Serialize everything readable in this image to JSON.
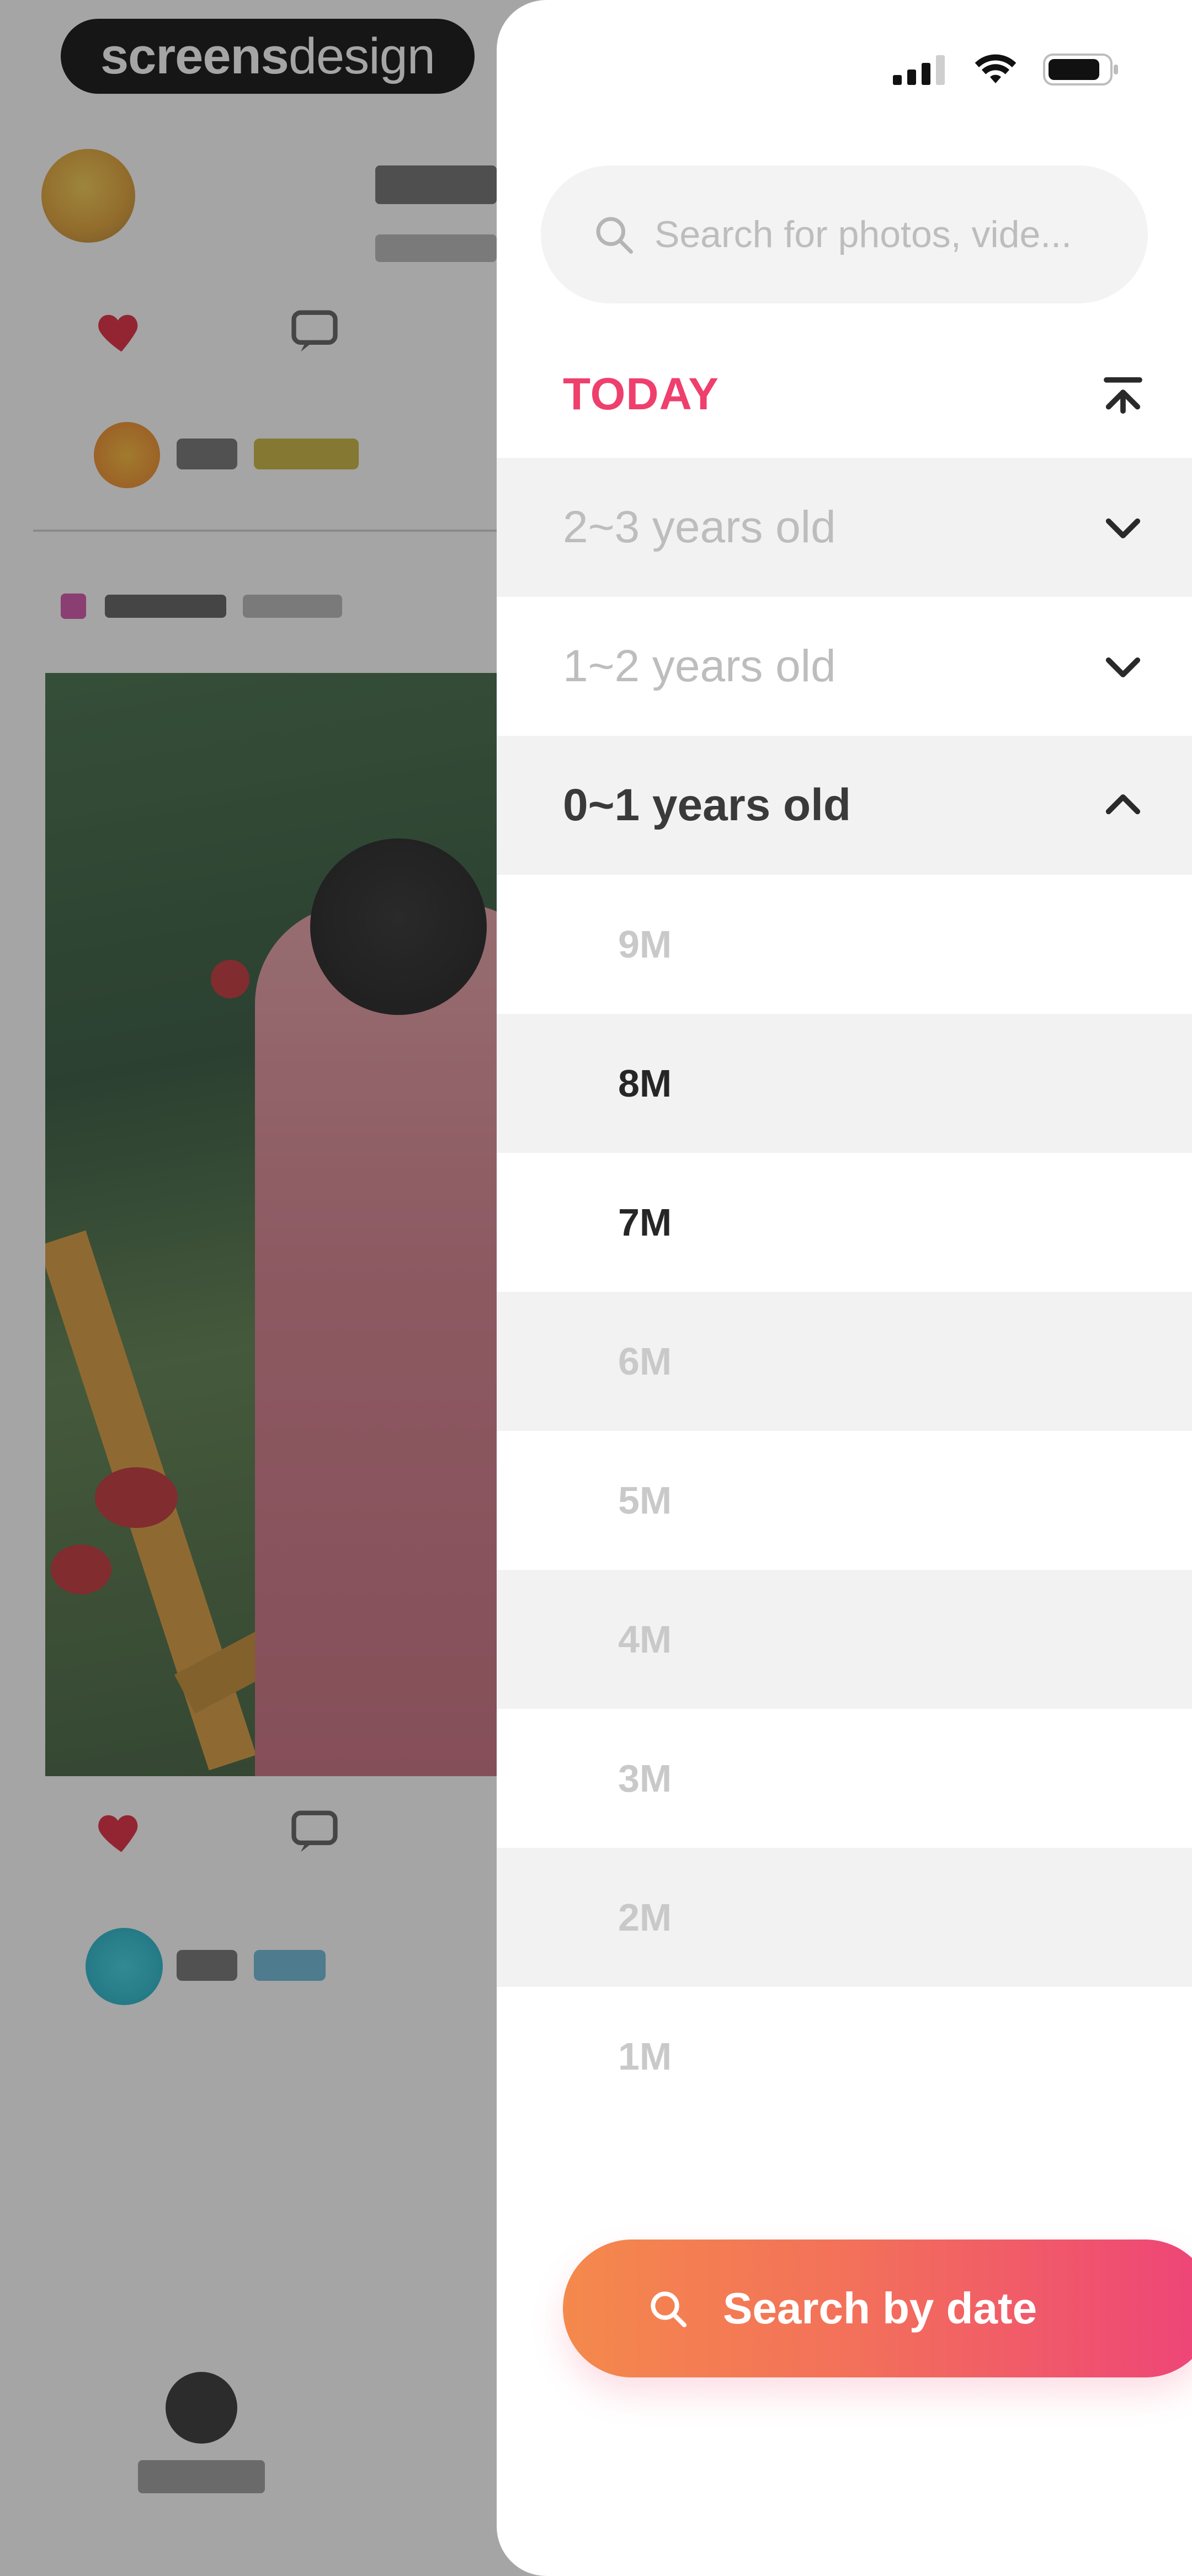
{
  "brand": {
    "bold": "screens",
    "light": "design"
  },
  "search": {
    "placeholder": "Search for photos, vide..."
  },
  "timeline": {
    "today_label": "TODAY",
    "age_groups": [
      {
        "label": "2~3 years old",
        "expanded": false
      },
      {
        "label": "1~2 years old",
        "expanded": false
      },
      {
        "label": "0~1 years old",
        "expanded": true
      }
    ],
    "months": [
      {
        "label": "9M",
        "active": false
      },
      {
        "label": "8M",
        "active": true
      },
      {
        "label": "7M",
        "active": true
      },
      {
        "label": "6M",
        "active": false
      },
      {
        "label": "5M",
        "active": false
      },
      {
        "label": "4M",
        "active": false
      },
      {
        "label": "3M",
        "active": false
      },
      {
        "label": "2M",
        "active": false
      },
      {
        "label": "1M",
        "active": false
      }
    ]
  },
  "cta": {
    "label": "Search by date"
  },
  "colors": {
    "accent_pink": "#ef3f6d",
    "gradient_start": "#f4894c",
    "gradient_end": "#ee4379",
    "row_shade": "#f2f2f2"
  },
  "icons": {
    "status": [
      "cellular-signal-icon",
      "wifi-icon",
      "battery-icon"
    ],
    "search": "search-icon",
    "collapse_top": "collapse-to-top-icon",
    "chevron_down": "chevron-down-icon",
    "chevron_up": "chevron-up-icon"
  }
}
